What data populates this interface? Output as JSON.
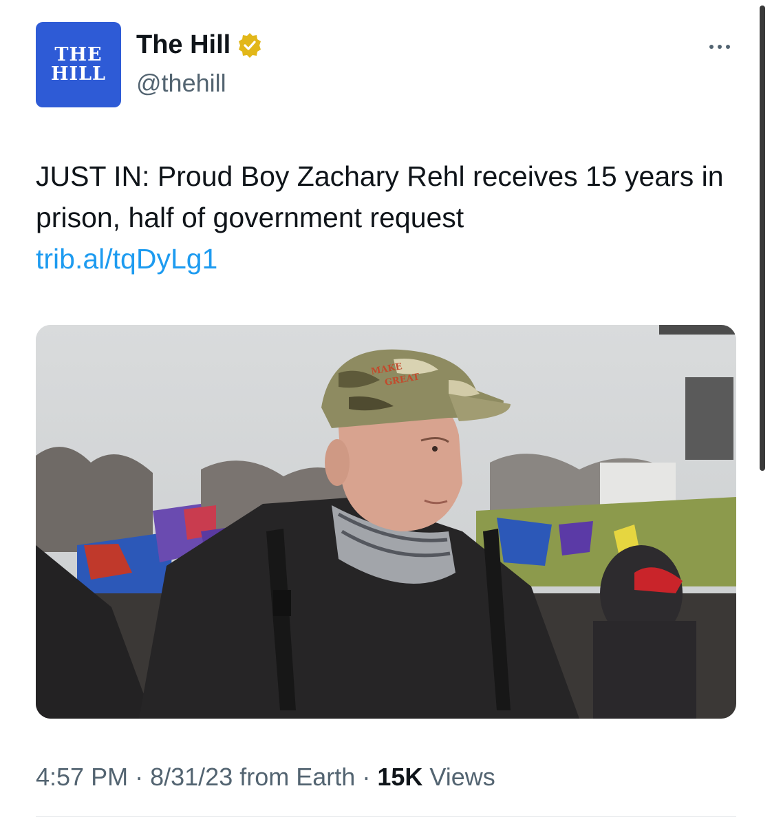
{
  "account": {
    "avatar_line1": "THE",
    "avatar_line2": "HILL",
    "display_name": "The Hill",
    "handle": "@thehill",
    "verified": true,
    "verified_color": "#e2b719"
  },
  "tweet": {
    "text": "JUST IN: Proud Boy Zachary Rehl receives 15 years in prison, half of government request",
    "link": "trib.al/tqDyLg1",
    "media_icon": "news-photo-image",
    "cap_text_line1": "MAKE",
    "cap_text_line2": "GREAT"
  },
  "meta": {
    "time": "4:57 PM",
    "date": "8/31/23",
    "source": "from Earth",
    "separator": "·",
    "views_count": "15K",
    "views_label": "Views"
  },
  "colors": {
    "link": "#1d9bf0",
    "secondary_text": "#536471",
    "avatar_bg": "#2e5bd6"
  }
}
